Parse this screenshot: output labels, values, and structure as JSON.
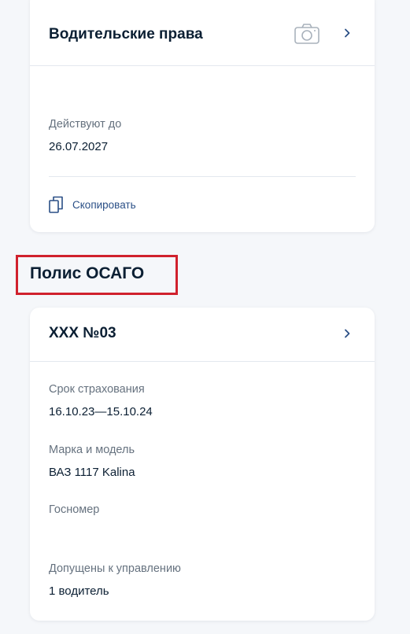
{
  "license_card": {
    "title": "Водительские права",
    "valid_until_label": "Действуют до",
    "valid_until_value": "26.07.2027",
    "copy_label": "Скопировать"
  },
  "osago_section": {
    "title": "Полис ОСАГО",
    "card": {
      "title": "ХХХ №03",
      "fields": [
        {
          "label": "Срок страхования",
          "value": "16.10.23—15.10.24"
        },
        {
          "label": "Марка и модель",
          "value": "ВАЗ 1117 Kalina"
        },
        {
          "label": "Госномер",
          "value": ""
        },
        {
          "label": "Допущены к управлению",
          "value": "1 водитель"
        }
      ]
    }
  },
  "icons": {
    "camera": "camera-icon",
    "chevron": "chevron-right-icon",
    "copy": "copy-icon"
  },
  "colors": {
    "highlight": "#d0212d",
    "link": "#2a4f86",
    "text": "#0b1f33",
    "muted": "#66727f"
  }
}
